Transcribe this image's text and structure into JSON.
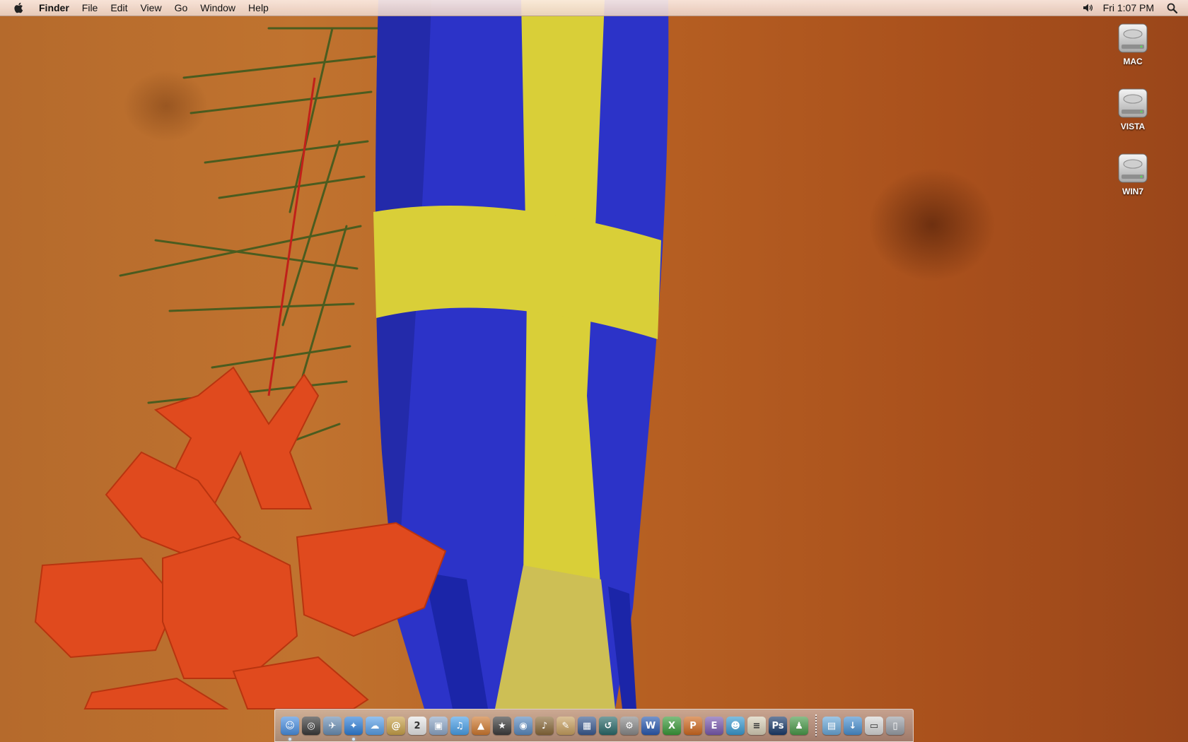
{
  "menubar": {
    "app_name": "Finder",
    "menus": [
      "File",
      "Edit",
      "View",
      "Go",
      "Window",
      "Help"
    ],
    "clock": "Fri 1:07 PM",
    "status_icons": [
      "volume-icon",
      "spotlight-icon"
    ]
  },
  "desktop": {
    "disks": [
      {
        "label": "MAC",
        "icon": "hard-drive-icon"
      },
      {
        "label": "VISTA",
        "icon": "hard-drive-icon"
      },
      {
        "label": "WIN7",
        "icon": "hard-drive-icon"
      }
    ]
  },
  "dock": {
    "apps": [
      {
        "name": "finder",
        "color": "#4a8fe0",
        "glyph": "☺",
        "running": true
      },
      {
        "name": "dashboard",
        "color": "#3a3a3a",
        "glyph": "◎",
        "running": false
      },
      {
        "name": "mail-stamp",
        "color": "#6b8fb5",
        "glyph": "✈",
        "running": false
      },
      {
        "name": "safari",
        "color": "#2f7fd8",
        "glyph": "✦",
        "running": true
      },
      {
        "name": "ichat",
        "color": "#5aa0e8",
        "glyph": "☁",
        "running": false
      },
      {
        "name": "address-book",
        "color": "#c9a24a",
        "glyph": "@",
        "running": false
      },
      {
        "name": "ical",
        "color": "#e8e8e8",
        "glyph": "2",
        "running": false
      },
      {
        "name": "preview",
        "color": "#8fa8c8",
        "glyph": "▣",
        "running": false
      },
      {
        "name": "itunes",
        "color": "#4aa0e8",
        "glyph": "♫",
        "running": false
      },
      {
        "name": "iphoto",
        "color": "#d07a30",
        "glyph": "▲",
        "running": false
      },
      {
        "name": "imovie",
        "color": "#3c3c3c",
        "glyph": "★",
        "running": false
      },
      {
        "name": "idvd",
        "color": "#5a8ac0",
        "glyph": "◉",
        "running": false
      },
      {
        "name": "garageband",
        "color": "#8a6a3a",
        "glyph": "♪",
        "running": false
      },
      {
        "name": "iweb",
        "color": "#c8a060",
        "glyph": "✎",
        "running": false
      },
      {
        "name": "spaces",
        "color": "#3a5a90",
        "glyph": "▦",
        "running": false
      },
      {
        "name": "time-machine",
        "color": "#2a6a6a",
        "glyph": "↺",
        "running": false
      },
      {
        "name": "system-preferences",
        "color": "#8a8a8a",
        "glyph": "⚙",
        "running": false
      },
      {
        "name": "word",
        "color": "#2a5ab0",
        "glyph": "W",
        "running": false
      },
      {
        "name": "excel",
        "color": "#3a9a3a",
        "glyph": "X",
        "running": false
      },
      {
        "name": "powerpoint",
        "color": "#d06a20",
        "glyph": "P",
        "running": false
      },
      {
        "name": "entourage",
        "color": "#7a5ab0",
        "glyph": "E",
        "running": false
      },
      {
        "name": "messenger",
        "color": "#3a9ad0",
        "glyph": "☻",
        "running": false
      },
      {
        "name": "document-library",
        "color": "#d8d0b8",
        "glyph": "≡",
        "running": false
      },
      {
        "name": "photoshop",
        "color": "#1a3a6a",
        "glyph": "Ps",
        "running": false
      },
      {
        "name": "user-icon",
        "color": "#4a9a4a",
        "glyph": "♟",
        "running": false
      }
    ],
    "stacks": [
      {
        "name": "applications-stack",
        "color": "#6aa8d8",
        "glyph": "▤"
      },
      {
        "name": "downloads-stack",
        "color": "#4a90d0",
        "glyph": "↓"
      },
      {
        "name": "documents-stack",
        "color": "#d8d8d8",
        "glyph": "▭"
      },
      {
        "name": "trash",
        "color": "#9aa0a8",
        "glyph": "▯"
      }
    ]
  }
}
